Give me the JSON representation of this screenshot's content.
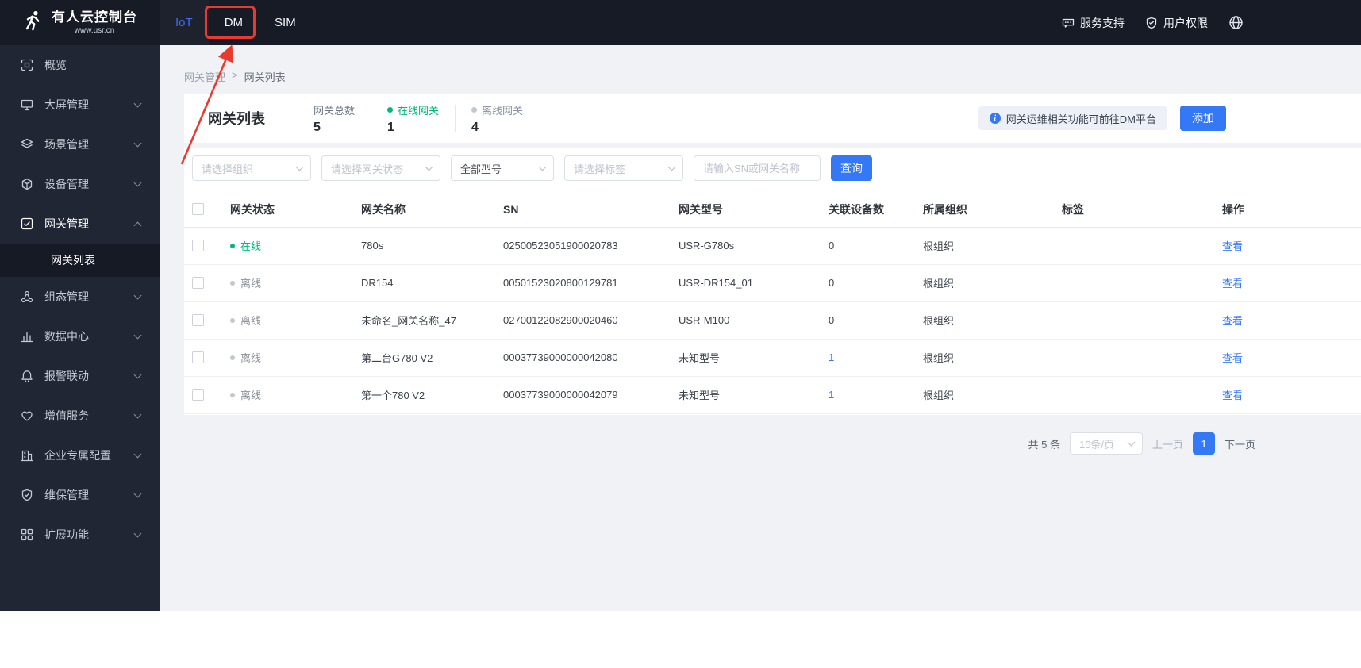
{
  "colors": {
    "accent": "#3478f6",
    "online_green": "#00b87a",
    "offline_gray": "#c3c7cf",
    "annotation_red": "#e93a2f",
    "topbar_bg": "#161b26",
    "sidebar_bg": "#202634"
  },
  "topbar": {
    "logo_title": "有人云控制台",
    "logo_subtitle": "www.usr.cn",
    "tabs": [
      {
        "label": "IoT"
      },
      {
        "label": "DM"
      },
      {
        "label": "SIM"
      }
    ],
    "links": [
      {
        "label": "服务支持"
      },
      {
        "label": "用户权限"
      }
    ]
  },
  "sidebar": {
    "items": [
      {
        "label": "概览"
      },
      {
        "label": "大屏管理"
      },
      {
        "label": "场景管理"
      },
      {
        "label": "设备管理"
      },
      {
        "label": "网关管理"
      },
      {
        "label": "组态管理"
      },
      {
        "label": "数据中心"
      },
      {
        "label": "报警联动"
      },
      {
        "label": "增值服务"
      },
      {
        "label": "企业专属配置"
      },
      {
        "label": "维保管理"
      },
      {
        "label": "扩展功能"
      }
    ],
    "submenu": {
      "label": "网关列表"
    }
  },
  "breadcrumb": {
    "parent": "网关管理",
    "separator": ">",
    "current": "网关列表"
  },
  "header": {
    "title": "网关列表",
    "stats": [
      {
        "label": "网关总数",
        "value": "5"
      },
      {
        "label": "在线网关",
        "value": "1"
      },
      {
        "label": "离线网关",
        "value": "4"
      }
    ],
    "info_banner": "网关运维相关功能可前往DM平台",
    "add_button": "添加"
  },
  "filters": {
    "org_placeholder": "请选择组织",
    "status_placeholder": "请选择网关状态",
    "model_value": "全部型号",
    "tag_placeholder": "请选择标签",
    "search_placeholder": "请输入SN或网关名称",
    "query_button": "查询"
  },
  "table": {
    "columns": [
      "网关状态",
      "网关名称",
      "SN",
      "网关型号",
      "关联设备数",
      "所属组织",
      "标签",
      "操作"
    ],
    "rows": [
      {
        "status": "在线",
        "name": "780s",
        "sn": "02500523051900020783",
        "model": "USR-G780s",
        "devices": "0",
        "org": "根组织",
        "tag": "",
        "action": "查看"
      },
      {
        "status": "离线",
        "name": "DR154",
        "sn": "00501523020800129781",
        "model": "USR-DR154_01",
        "devices": "0",
        "org": "根组织",
        "tag": "",
        "action": "查看"
      },
      {
        "status": "离线",
        "name": "未命名_网关名称_47",
        "sn": "02700122082900020460",
        "model": "USR-M100",
        "devices": "0",
        "org": "根组织",
        "tag": "",
        "action": "查看"
      },
      {
        "status": "离线",
        "name": "第二台G780 V2",
        "sn": "00037739000000042080",
        "model": "未知型号",
        "devices": "1",
        "org": "根组织",
        "tag": "",
        "action": "查看"
      },
      {
        "status": "离线",
        "name": "第一个780 V2",
        "sn": "00037739000000042079",
        "model": "未知型号",
        "devices": "1",
        "org": "根组织",
        "tag": "",
        "action": "查看"
      }
    ]
  },
  "pagination": {
    "total": "共 5 条",
    "page_size": "10条/页",
    "prev": "上一页",
    "page": "1",
    "next": "下一页"
  }
}
